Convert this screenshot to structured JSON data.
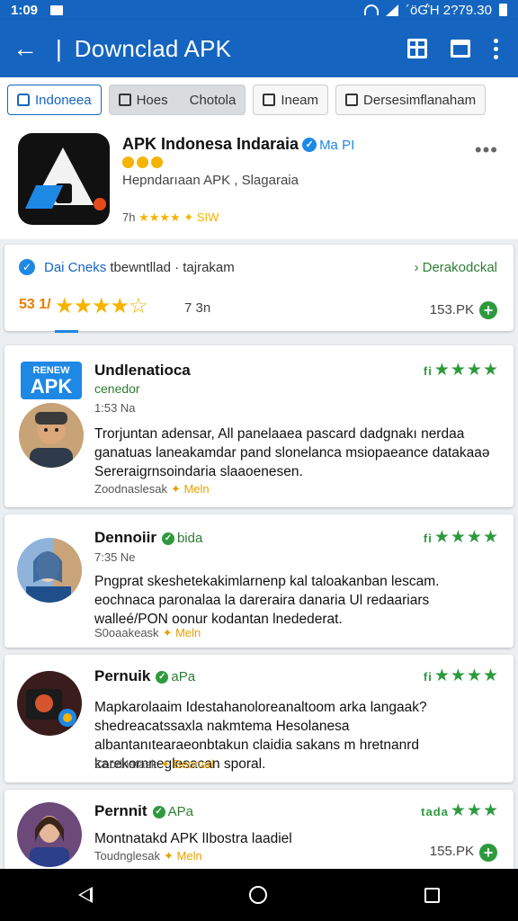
{
  "status": {
    "time": "1:09",
    "indicators": "´öƓΉ 2?79.30"
  },
  "appbar": {
    "title": "Downclad APK",
    "divider": "|"
  },
  "tabs": [
    "Indoneea",
    "Hoes",
    "Chotola",
    "Ineam",
    "Dersesimflanaham"
  ],
  "app": {
    "name": "APK Indonesa Indaraia",
    "badge": "Ma PI",
    "developer": "Hepndarıaan APK , Slagaraia",
    "meta_prefix": "7h",
    "meta_stars": "★★★★",
    "meta_suffix": "✦ SIW",
    "more": "•••"
  },
  "download": {
    "title": "Dai Cneks",
    "subtitle": "tbewntllad · tajrakam",
    "action": "› Derakodckal",
    "rating": "53 1/",
    "stars": "★★★★☆",
    "count": "7 3n",
    "size": "153.PK"
  },
  "reviews": [
    {
      "name": "Undlenatioca",
      "logo_top": "RENEW",
      "logo_bottom": "APK",
      "subtitle": "cenedor",
      "date": "1:53 Na",
      "stars_prefix": "fi",
      "stars": "★★★★",
      "text": "Trorjuntan adensar, All panelaaea pascard dadgnakı nerdaa ganatuas laneakamdar pand slonelanca msiopaeance datakaaə Sereraigrnsoindaria slaaoenesen.",
      "footer": "Zoodnaslesak",
      "help": "✦ Meln"
    },
    {
      "name": "Dennoiir",
      "tag": "bida",
      "date": "7:35 Ne",
      "stars_prefix": "fi",
      "stars": "★★★★",
      "text": "Pngprat skeshetekakimlarnenp kal taloakanban lescam. eochnaca paronalaa la dareraira danaria Ul redaariars walleé/PON oonur kodantan lnedederat.",
      "footer": "S0oaakeask",
      "help": "✦ Meln"
    },
    {
      "name": "Pernuik",
      "tag": "aPa",
      "stars_prefix": "fi",
      "stars": "★★★★",
      "text": "Mapkarolaaim Idestahanoloreanaltoom arka langaak? shedreacatssaxla nakmtema Hesolanesa albantanıtearaeonbtakun claidia sakans m hretnanrd karekornneglesacan sporal.",
      "footer": "Coodnatask",
      "help": "✦ Beonarl"
    },
    {
      "name": "Pernnit",
      "tag": "APa",
      "stars_prefix": "tada",
      "stars": "★★★",
      "text": "Montnatakd APK lIbostra laadiel",
      "footer": "Toudnglesak",
      "help": "✦ Meln",
      "size": "155.PK"
    }
  ],
  "colors": {
    "primary": "#1565c0",
    "accent_green": "#2e9a3e",
    "star": "#f4b400"
  }
}
